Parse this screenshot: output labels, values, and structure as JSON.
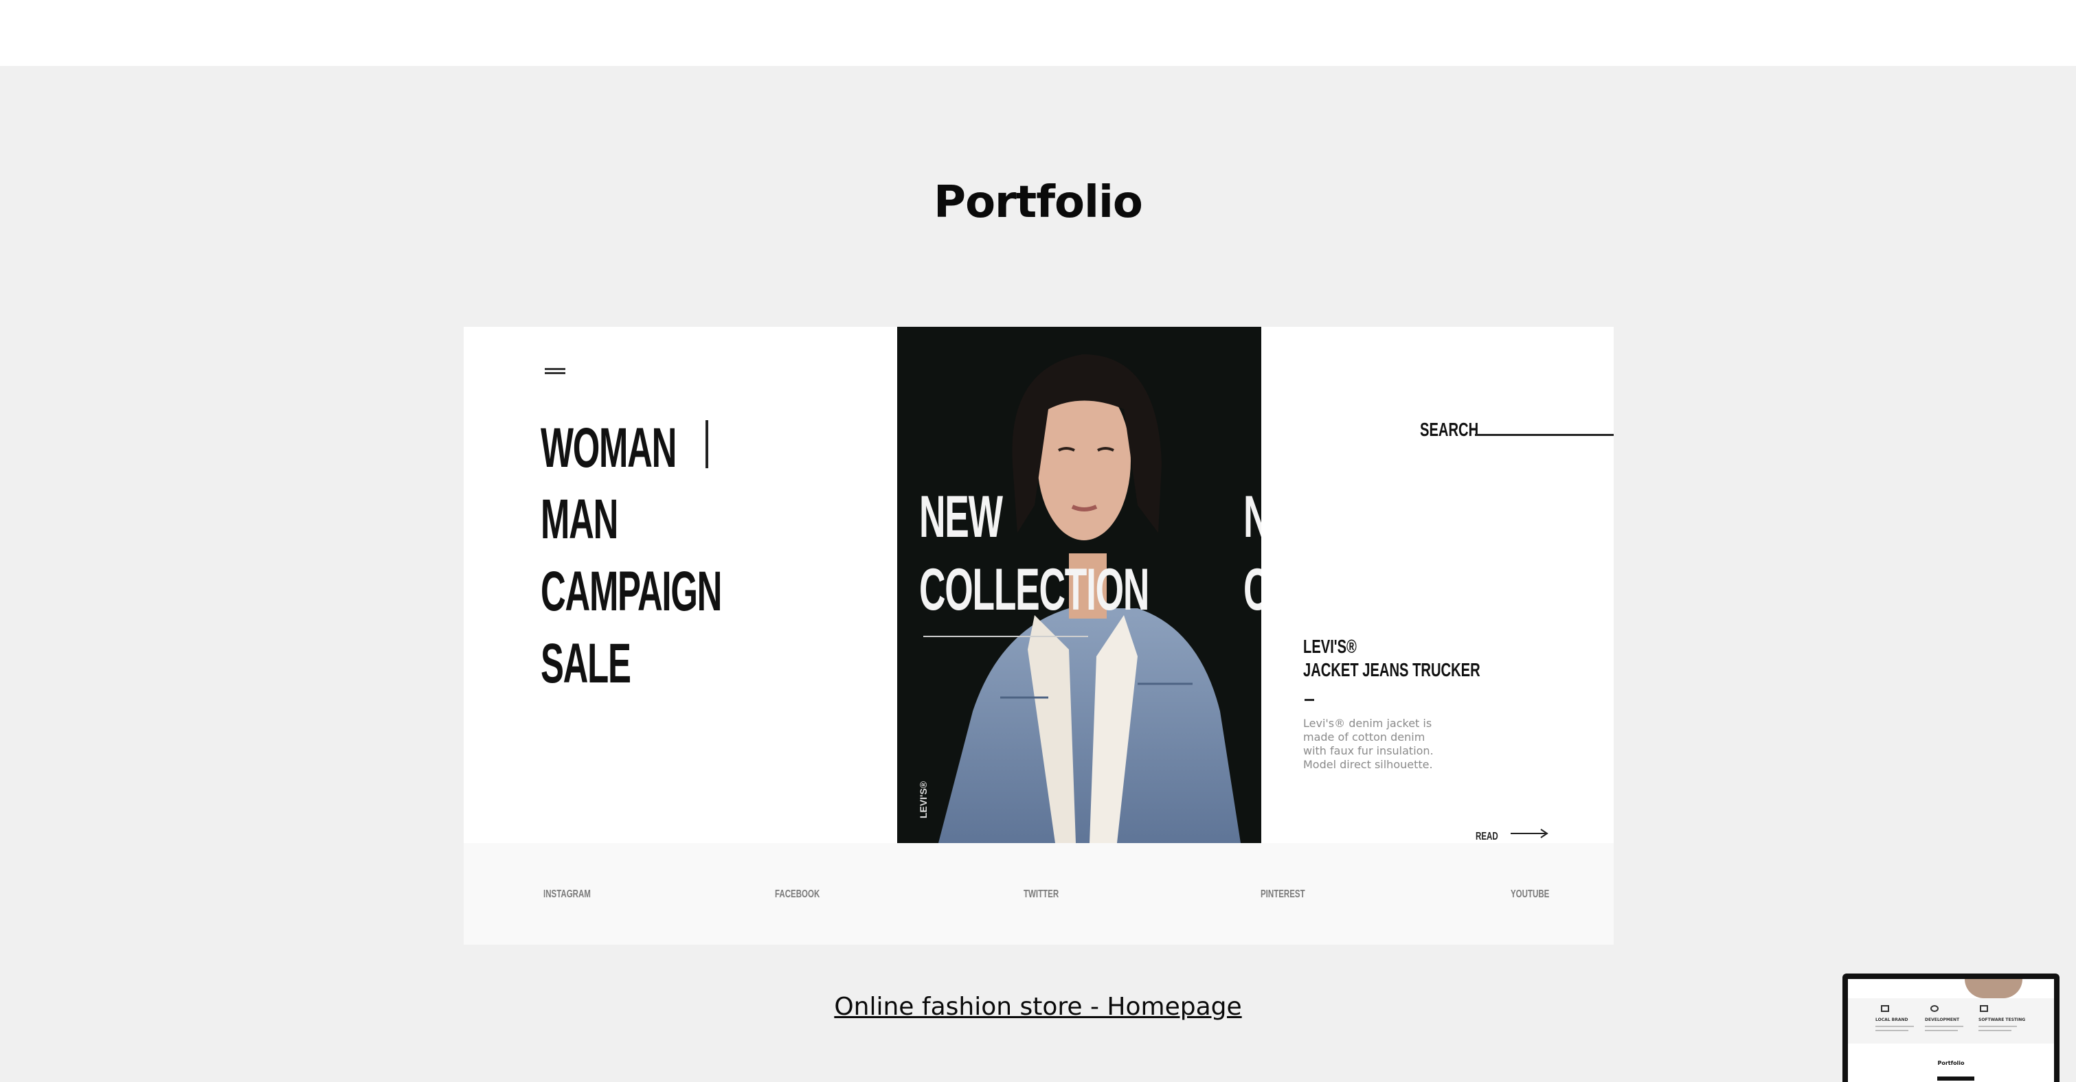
{
  "section": {
    "title": "Portfolio"
  },
  "project": {
    "caption": "Online fashion store - Homepage",
    "mockup": {
      "menu": [
        "WOMAN",
        "MAN",
        "CAMPAIGN",
        "SALE"
      ],
      "hero": {
        "line1": "NEW",
        "line2": "COLLECTION",
        "ghost1": "N",
        "ghost2": "C",
        "brand_vertical": "LEVI'S®"
      },
      "search_label": "SEARCH",
      "product": {
        "brand": "LEVI'S®",
        "name": "JACKET JEANS TRUCKER",
        "description": "Levi's® denim jacket is made of cotton denim with faux fur insulation. Model direct silhouette.",
        "read_label": "READ"
      },
      "social": [
        "INSTAGRAM",
        "FACEBOOK",
        "TWITTER",
        "PINTEREST",
        "YOUTUBE"
      ]
    }
  },
  "preview": {
    "columns": [
      "LOCAL BRAND",
      "DEVELOPMENT",
      "SOFTWARE TESTING"
    ],
    "title": "Portfolio"
  }
}
